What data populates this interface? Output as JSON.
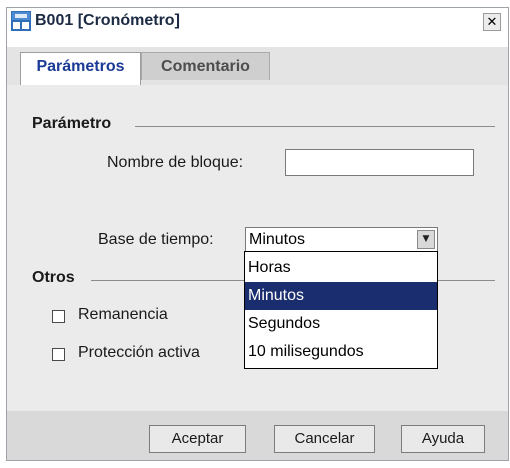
{
  "window": {
    "title": "B001 [Cronómetro]",
    "close_glyph": "✕"
  },
  "tabs": [
    {
      "label": "Parámetros",
      "active": true
    },
    {
      "label": "Comentario",
      "active": false
    }
  ],
  "parametro": {
    "group_label": "Parámetro",
    "block_name_label": "Nombre de bloque:",
    "block_name_value": "",
    "time_base_label": "Base de tiempo:",
    "time_base_value": "Minutos",
    "time_base_options": [
      "Horas",
      "Minutos",
      "Segundos",
      "10 milisegundos"
    ],
    "selected_option_index": 1
  },
  "otros": {
    "group_label": "Otros",
    "remanencia_label": "Remanencia",
    "remanencia_checked": false,
    "proteccion_label": "Protección activa",
    "proteccion_checked": false
  },
  "buttons": {
    "ok_label": "Aceptar",
    "cancel_label": "Cancelar",
    "help_label": "Ayuda"
  },
  "colors": {
    "active_tab_text": "#1a3a96",
    "selection_bg": "#1a2d6e",
    "title_text": "#1c2a44"
  },
  "icons": {
    "app": "logo-app-icon",
    "close": "close-icon",
    "combo_arrow": "chevron-down-icon"
  }
}
